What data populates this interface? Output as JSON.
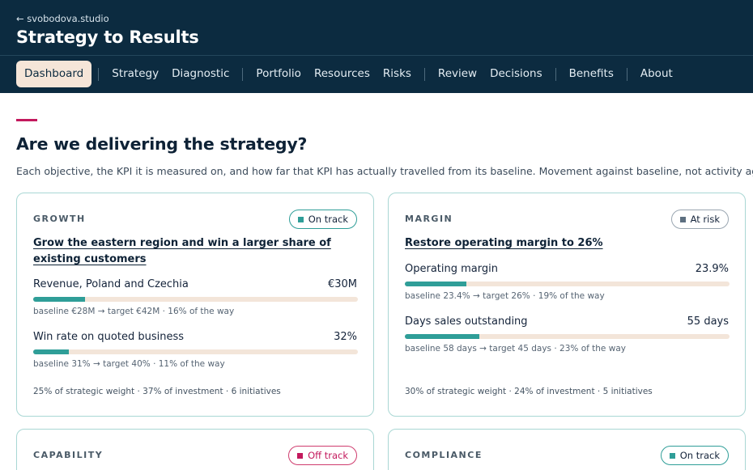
{
  "header": {
    "back_link": "← svobodova.studio",
    "title": "Strategy to Results",
    "tabs": [
      "Dashboard",
      "Strategy",
      "Diagnostic",
      "Portfolio",
      "Resources",
      "Risks",
      "Review",
      "Decisions",
      "Benefits",
      "About"
    ],
    "active_tab": "Dashboard"
  },
  "main": {
    "heading": "Are we delivering the strategy?",
    "description": "Each objective, the KPI it is measured on, and how far that KPI has actually travelled from its baseline. Movement against baseline, not activity again"
  },
  "cards": [
    {
      "label": "GROWTH",
      "status": "On track",
      "objective": "Grow the eastern region and win a larger share of existing customers",
      "kpis": [
        {
          "name": "Revenue, Poland and Czechia",
          "value": "€30M",
          "progress": 0.16,
          "meta": "baseline €28M → target €42M · 16% of the way"
        },
        {
          "name": "Win rate on quoted business",
          "value": "32%",
          "progress": 0.11,
          "meta": "baseline 31% → target 40% · 11% of the way"
        }
      ],
      "footer": "25% of strategic weight · 37% of investment · 6 initiatives"
    },
    {
      "label": "MARGIN",
      "status": "At risk",
      "objective": "Restore operating margin to 26%",
      "kpis": [
        {
          "name": "Operating margin",
          "value": "23.9%",
          "progress": 0.19,
          "meta": "baseline 23.4% → target 26% · 19% of the way"
        },
        {
          "name": "Days sales outstanding",
          "value": "55 days",
          "progress": 0.23,
          "meta": "baseline 58 days → target 45 days · 23% of the way"
        }
      ],
      "footer": "30% of strategic weight · 24% of investment · 5 initiatives"
    },
    {
      "label": "CAPABILITY",
      "status": "Off track"
    },
    {
      "label": "COMPLIANCE",
      "status": "On track"
    }
  ],
  "colors": {
    "header_bg": "#0c2b40",
    "accent": "#c3195d",
    "progress_fill": "#2f9e98",
    "progress_track": "#f3e5d9",
    "active_tab_bg": "#f5e5d8"
  }
}
